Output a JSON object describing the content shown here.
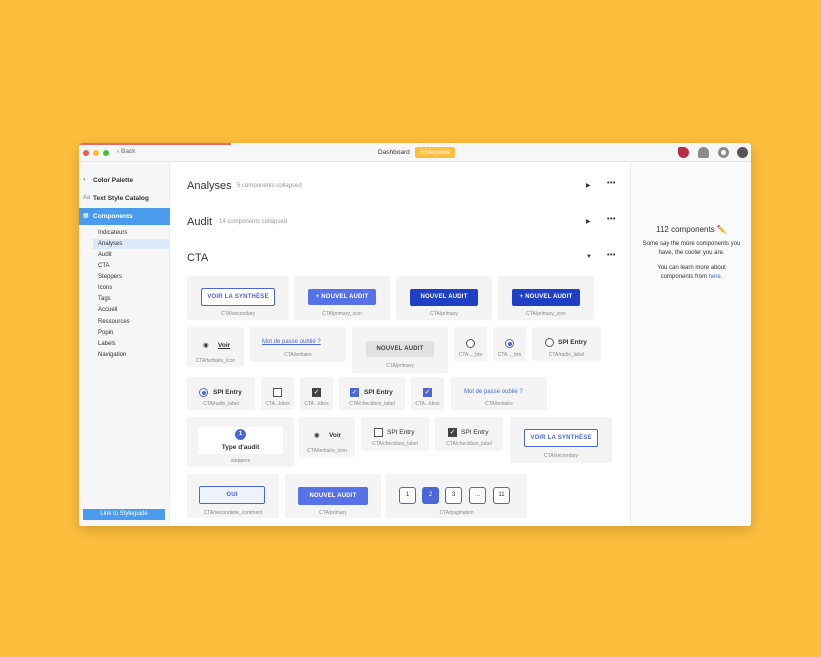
{
  "window": {
    "back_label": "Back",
    "tabs": [
      "Dashboard",
      "Styleguide"
    ],
    "dot_colors": [
      "#EF5B57",
      "#F6BD2E",
      "#3FC23B"
    ]
  },
  "sidebar": {
    "items": [
      {
        "label": "Color Palette",
        "icon": "palette-icon"
      },
      {
        "label": "Text Style Catalog",
        "icon": "text-style-icon"
      },
      {
        "label": "Components",
        "icon": "components-icon"
      }
    ],
    "sub_items": [
      "Indicateurs",
      "Analyses",
      "Audit",
      "CTA",
      "Steppers",
      "Icons",
      "Tags",
      "Accueil",
      "Ressources",
      "Popin",
      "Labels",
      "Navigation"
    ],
    "link_button": "Link to Styleguide"
  },
  "sections": [
    {
      "title": "Analyses",
      "subtitle": "5 components collapsed"
    },
    {
      "title": "Audit",
      "subtitle": "14 components collapsed"
    },
    {
      "title": "CTA",
      "subtitle": ""
    }
  ],
  "components": {
    "voir_synthese": "VOIR LA SYNTHÈSE",
    "nouvel_audit": "NOUVEL AUDIT",
    "nouvel_audit_plus": "+ NOUVEL AUDIT",
    "voir": "Voir",
    "mot_de_passe": "Mot de passe oublié ?",
    "spi_entry": "SPI Entry",
    "type_audit": "Type d'audit",
    "step_number": "1",
    "oui": "OUI",
    "pagination": [
      "1",
      "2",
      "3",
      "...",
      "11"
    ],
    "captions": {
      "secondary": "CTA/secondary",
      "primary_icon": "CTA/primary_icon",
      "primary": "CTA/primary",
      "tertiaire_icon": "CTA/tertiaire_icon",
      "tertiaire": "CTA/tertiaire",
      "btn": "CTA..._btn",
      "radio_label": "CTA/radio_label",
      "kbox": "CTA...kbox",
      "checkbox_label": "CTA/checkbox_label",
      "steppers": "steppers",
      "secondaire_comment": "CTA/secondaire_comment",
      "pagination": "CTA/pagination"
    }
  },
  "right_panel": {
    "count": "112 components ✏️",
    "line1": "Some say the more components you",
    "line2": "have, the cooler you are.",
    "line3": "You can learn more about",
    "line4_prefix": "components from",
    "line4_link": "here"
  },
  "colors": {
    "background": "#FEBE3D",
    "accent_blue": "#4A9BEB",
    "primary_dark": "#1F3FC4",
    "primary_mid": "#5672E6",
    "outline": "#4A66D9"
  }
}
